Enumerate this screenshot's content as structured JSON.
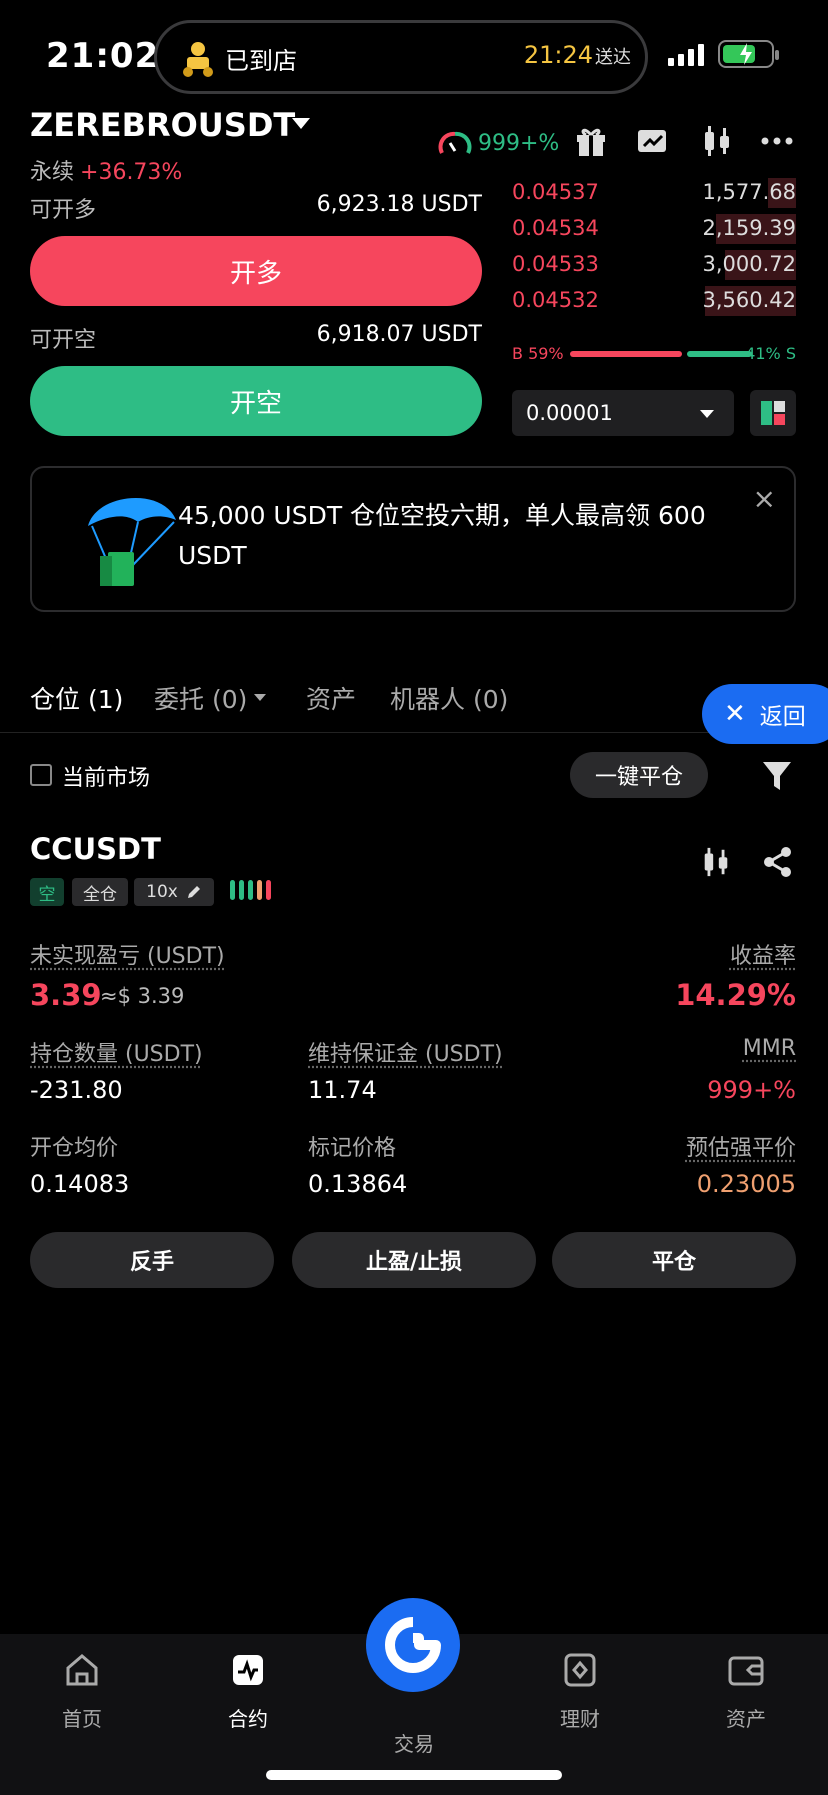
{
  "status_bar": {
    "time": "21:02",
    "island_text": "已到店",
    "island_eta": "21:24",
    "island_eta_suffix": "送达"
  },
  "header": {
    "pair": "ZEREBROUSDT",
    "contract_type": "永续",
    "change": "+36.73%",
    "gauge_value": "999+%",
    "icons": [
      "gift-icon",
      "card-icon",
      "candlestick-icon",
      "more-icon"
    ]
  },
  "trade": {
    "long_available_label": "可开多",
    "long_available_value": "6,923.18 USDT",
    "long_button": "开多",
    "short_available_label": "可开空",
    "short_available_value": "6,918.07 USDT",
    "short_button": "开空"
  },
  "order_book": {
    "asks": [
      {
        "price": "0.04537",
        "qty": "1,577.68",
        "depth": 0.1
      },
      {
        "price": "0.04534",
        "qty": "2,159.39",
        "depth": 0.28
      },
      {
        "price": "0.04533",
        "qty": "3,000.72",
        "depth": 0.25
      },
      {
        "price": "0.04532",
        "qty": "3,560.42",
        "depth": 0.32
      }
    ],
    "buy_ratio": "B 59%",
    "sell_ratio": "41% S",
    "buy_fraction": 0.59,
    "precision": "0.00001"
  },
  "banner": {
    "text": "45,000 USDT 仓位空投六期，单人最高领 600 USDT",
    "close": "×"
  },
  "tabs": {
    "positions": "仓位 (1)",
    "orders": "委托 (0)",
    "assets": "资产",
    "bots": "机器人 (0)",
    "back": "返回",
    "back_x": "✕"
  },
  "filter_bar": {
    "current_market": "当前市场",
    "close_all": "一键平仓"
  },
  "position": {
    "symbol": "CCUSDT",
    "side_tag": "空",
    "mode_tag": "全仓",
    "leverage_tag": "10x",
    "unrealized_label": "未实现盈亏 (USDT)",
    "unrealized_value": "3.39",
    "unrealized_usd": "≈$ 3.39",
    "roe_label": "收益率",
    "roe_value": "14.29%",
    "size_label": "持仓数量 (USDT)",
    "size_value": "-231.80",
    "margin_label": "维持保证金 (USDT)",
    "margin_value": "11.74",
    "mmr_label": "MMR",
    "mmr_value": "999+%",
    "entry_label": "开仓均价",
    "entry_value": "0.14083",
    "mark_label": "标记价格",
    "mark_value": "0.13864",
    "liq_label": "预估强平价",
    "liq_value": "0.23005",
    "btn_reverse": "反手",
    "btn_tpsl": "止盈/止损",
    "btn_close": "平仓"
  },
  "nav": {
    "home": "首页",
    "futures": "合约",
    "trade": "交易",
    "earn": "理财",
    "assets": "资产"
  }
}
